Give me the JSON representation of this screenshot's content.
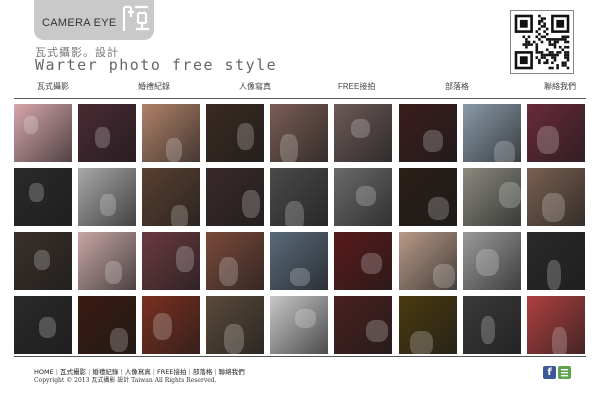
{
  "logo": {
    "text": "CAMERA EYE",
    "mark_icon": "camera-eye-logo-mark"
  },
  "brand": {
    "chinese": "瓦式攝影。設計",
    "english": "Warter photo free style"
  },
  "nav": {
    "items": [
      {
        "label": "瓦式攝影"
      },
      {
        "label": "婚禮紀錄"
      },
      {
        "label": "人像寫真"
      },
      {
        "label": "FREE接拍"
      },
      {
        "label": "部落格"
      },
      {
        "label": "聯絡我們"
      }
    ]
  },
  "gallery": {
    "rows": 4,
    "cols": 9,
    "photo_tones": [
      [
        "#d7a7ac",
        "#4a2a33",
        "#b0826a",
        "#3a2b22",
        "#7a5d55",
        "#6b5a58",
        "#3b1d1d",
        "#8a9aa8",
        "#6a2a3a"
      ],
      [
        "#2a2a2a",
        "#a8a8a8",
        "#5a4030",
        "#3a2a2a",
        "#4a4a4a",
        "#6a6a6a",
        "#2a1e18",
        "#8a8a80",
        "#7a6050"
      ],
      [
        "#3a302a",
        "#c8a6a6",
        "#6a3a40",
        "#7a4a3a",
        "#5a6a7a",
        "#5a1a1a",
        "#b89a88",
        "#9a9a9a",
        "#2a2a2a"
      ],
      [
        "#2a2a2a",
        "#3a1a10",
        "#7a3020",
        "#5a4a3a",
        "#c8c8c8",
        "#4a2020",
        "#4a3a10",
        "#3a3a3a",
        "#b04040"
      ]
    ]
  },
  "footer": {
    "links": [
      {
        "label": "HOME"
      },
      {
        "label": "瓦式攝影"
      },
      {
        "label": "婚禮紀錄"
      },
      {
        "label": "人像寫真"
      },
      {
        "label": "FREE接拍"
      },
      {
        "label": "部落格"
      },
      {
        "label": "聯絡我們"
      }
    ],
    "copyright": "Copyright © 2013 瓦式攝影 設計 Taiwan All Rights Reserved.",
    "facebook_icon": "facebook-icon",
    "facebook_letter": "f",
    "second_icon": "share-icon"
  },
  "colors": {
    "header_tab": "#c9c9c9",
    "rule": "#555555",
    "facebook": "#3b5998",
    "share": "#5fa34f"
  }
}
